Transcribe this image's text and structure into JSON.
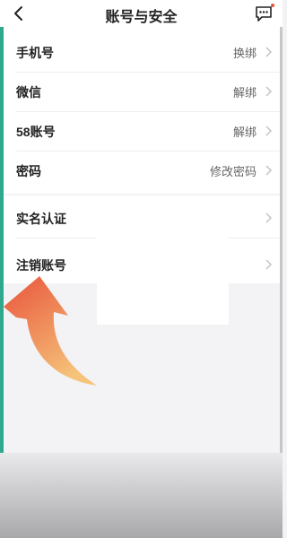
{
  "header": {
    "title": "账号与安全",
    "back_icon": "chevron-left-icon",
    "message_icon": "message-icon"
  },
  "account_items": [
    {
      "label": "手机号",
      "value": "换绑"
    },
    {
      "label": "微信",
      "value": "解绑"
    },
    {
      "label": "58账号",
      "value": "解绑"
    },
    {
      "label": "密码",
      "value": "修改密码"
    }
  ],
  "verification_item": {
    "label": "实名认证"
  },
  "cancel_item": {
    "label": "注销账号"
  },
  "colors": {
    "arrow_top": "#e8533b",
    "arrow_bottom": "#f6c37a",
    "notification_dot": "#e8533b"
  }
}
